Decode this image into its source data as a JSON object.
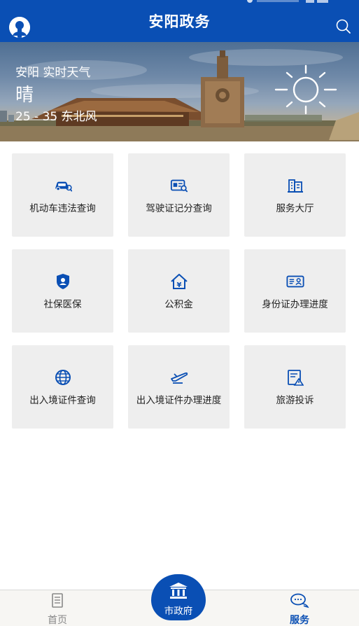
{
  "header": {
    "title": "安阳政务",
    "avatar_icon": "user-avatar-icon",
    "search_icon": "search-icon",
    "bg_color": "#0a4fb4"
  },
  "weather": {
    "location": "安阳 实时天气",
    "condition": "晴",
    "temp_wind": "25 - 35    东北风",
    "icon": "sun-icon"
  },
  "services": [
    {
      "label": "机动车违法查询",
      "icon": "car-search-icon"
    },
    {
      "label": "驾驶证记分查询",
      "icon": "license-search-icon"
    },
    {
      "label": "服务大厅",
      "icon": "building-icon"
    },
    {
      "label": "社保医保",
      "icon": "shield-user-icon"
    },
    {
      "label": "公积金",
      "icon": "home-yen-icon"
    },
    {
      "label": "身份证办理进度",
      "icon": "id-card-icon"
    },
    {
      "label": "出入境证件查询",
      "icon": "globe-icon"
    },
    {
      "label": "出入境证件办理进度",
      "icon": "airplane-icon"
    },
    {
      "label": "旅游投诉",
      "icon": "complaint-icon"
    }
  ],
  "bottom_nav": {
    "home_label": "首页",
    "center_label": "市政府",
    "service_label": "服务",
    "active_color": "#0a4fb4",
    "inactive_color": "#888888"
  }
}
